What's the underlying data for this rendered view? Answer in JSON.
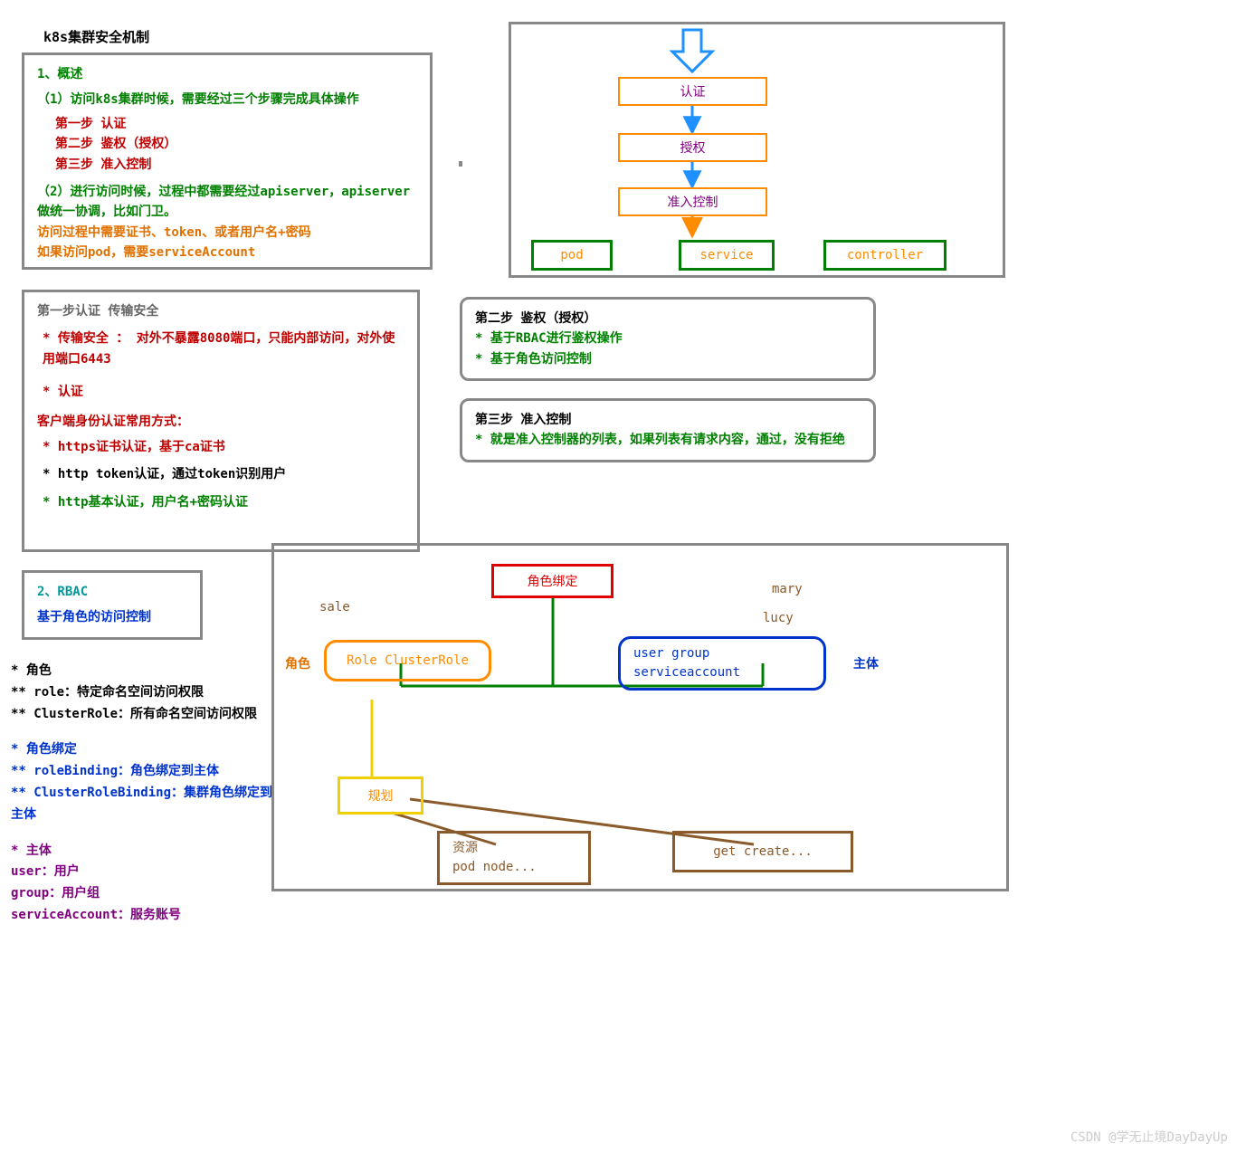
{
  "title": "k8s集群安全机制",
  "overview": {
    "heading": "1、概述",
    "p1": "（1）访问k8s集群时候，需要经过三个步骤完成具体操作",
    "step1": "第一步  认证",
    "step2": "第二步  鉴权（授权）",
    "step3": "第三步  准入控制",
    "p2a": "（2）进行访问时候，过程中都需要经过apiserver，apiserver做统一协调，比如门卫。",
    "p2b": "访问过程中需要证书、token、或者用户名+密码",
    "p2c": "如果访问pod，需要serviceAccount"
  },
  "flow": {
    "n1": "认证",
    "n2": "授权",
    "n3": "准入控制",
    "leaf1": "pod",
    "leaf2": "service",
    "leaf3": "controller"
  },
  "step1box": {
    "title": "第一步认证 传输安全",
    "l1": "* 传输安全 ：  对外不暴露8080端口，只能内部访问，对外使用端口6443",
    "l2": "* 认证",
    "l3": "客户端身份认证常用方式：",
    "l4": "* https证书认证，基于ca证书",
    "l5": "* http token认证，通过token识别用户",
    "l6": "* http基本认证，用户名+密码认证"
  },
  "step2box": {
    "title": "第二步  鉴权（授权）",
    "l1": "* 基于RBAC进行鉴权操作",
    "l2": "* 基于角色访问控制"
  },
  "step3box": {
    "title": "第三步  准入控制",
    "l1": "* 就是准入控制器的列表，如果列表有请求内容，通过，没有拒绝"
  },
  "rbacbox": {
    "title": "2、RBAC",
    "sub": "基于角色的访问控制"
  },
  "rbactext": {
    "h1": "* 角色",
    "h1a": "** role：特定命名空间访问权限",
    "h1b": "** ClusterRole：所有命名空间访问权限",
    "h2": "* 角色绑定",
    "h2a": "** roleBinding：角色绑定到主体",
    "h2b": "** ClusterRoleBinding：集群角色绑定到主体",
    "h3": "* 主体",
    "h3a": "user：用户",
    "h3b": "group：用户组",
    "h3c": "serviceAccount：服务账号"
  },
  "rbacdiagram": {
    "binding": "角色绑定",
    "role": "Role ClusterRole",
    "subjectL1": "user group",
    "subjectL2": "serviceaccount",
    "plan": "规划",
    "res": "资源",
    "resSub": "pod  node...",
    "act": "get  create...",
    "roleLabel": "角色",
    "subjectLabel": "主体",
    "sale": "sale",
    "mary": "mary",
    "lucy": "lucy"
  },
  "watermark": "CSDN @学无止境DayDayUp"
}
